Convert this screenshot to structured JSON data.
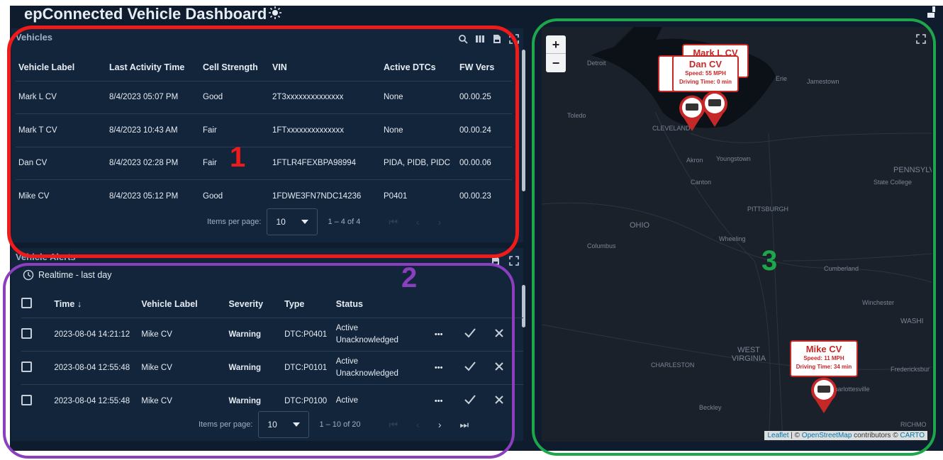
{
  "header": {
    "title": "epConnected Vehicle Dashboard"
  },
  "vehicles_panel": {
    "title": "Vehicles",
    "columns": [
      "Vehicle Label",
      "Last Activity Time",
      "Cell Strength",
      "VIN",
      "Active DTCs",
      "FW Vers"
    ],
    "rows": [
      [
        "Mark L CV",
        "8/4/2023 05:07 PM",
        "Good",
        "2T3xxxxxxxxxxxxxx",
        "None",
        "00.00.25"
      ],
      [
        "Mark T CV",
        "8/4/2023 10:43 AM",
        "Fair",
        "1FTxxxxxxxxxxxxxx",
        "None",
        "00.00.24"
      ],
      [
        "Dan CV",
        "8/4/2023 02:28 PM",
        "Fair",
        "1FTLR4FEXBPA98994",
        "PIDA, PIDB, PIDC",
        "00.00.06"
      ],
      [
        "Mike CV",
        "8/4/2023 05:12 PM",
        "Good",
        "1FDWE3FN7NDC14236",
        "P0401",
        "00.00.23"
      ]
    ],
    "paginator": {
      "items_label": "Items per page:",
      "per_page": "10",
      "range": "1 – 4 of 4"
    }
  },
  "alerts_panel": {
    "title": "Vehicle Alerts",
    "time_filter": "Realtime - last day",
    "columns": [
      "Time ↓",
      "Vehicle Label",
      "Severity",
      "Type",
      "Status"
    ],
    "rows": [
      {
        "time": "2023-08-04 14:21:12",
        "vehicle": "Mike CV",
        "severity": "Warning",
        "type": "DTC:P0401",
        "status1": "Active",
        "status2": "Unacknowledged"
      },
      {
        "time": "2023-08-04 12:55:48",
        "vehicle": "Mike CV",
        "severity": "Warning",
        "type": "DTC:P0101",
        "status1": "Active",
        "status2": "Unacknowledged"
      },
      {
        "time": "2023-08-04 12:55:48",
        "vehicle": "Mike CV",
        "severity": "Warning",
        "type": "DTC:P0100",
        "status1": "Active",
        "status2": ""
      }
    ],
    "more_label": "•••",
    "paginator": {
      "items_label": "Items per page:",
      "per_page": "10",
      "range": "1 – 10 of 20"
    }
  },
  "map": {
    "zoom_in": "+",
    "zoom_out": "−",
    "places": [
      "Detroit",
      "Toledo",
      "CLEVELAND",
      "Akron",
      "Youngstown",
      "Canton",
      "OHIO",
      "PITTSBURGH",
      "Columbus",
      "Wheeling",
      "Erie",
      "Jamestown",
      "PENNSYLV",
      "State College",
      "Cumberland",
      "Winchester",
      "WASHI",
      "CHARLESTON",
      "WEST VIRGINIA",
      "Fredericksbur",
      "Charlottesville",
      "Beckley",
      "RICHMO"
    ],
    "popups": {
      "mark_l": {
        "name": "Mark L CV"
      },
      "dan": {
        "name": "Dan CV",
        "speed": "Speed: 55 MPH",
        "driving": "Driving Time: 0 min"
      },
      "mike": {
        "name": "Mike CV",
        "speed": "Speed: 11 MPH",
        "driving": "Driving Time: 34 min"
      }
    },
    "attribution": {
      "leaflet": "Leaflet",
      "sep": " | © ",
      "osm": "OpenStreetMap",
      "contrib": " contributors © ",
      "carto": "CARTO"
    }
  },
  "annotations": {
    "n1": "1",
    "n2": "2",
    "n3": "3"
  },
  "colors": {
    "red": "#ef1a1a",
    "purple": "#8b3fbf",
    "green": "#1ea64a",
    "popup": "#c62828"
  }
}
